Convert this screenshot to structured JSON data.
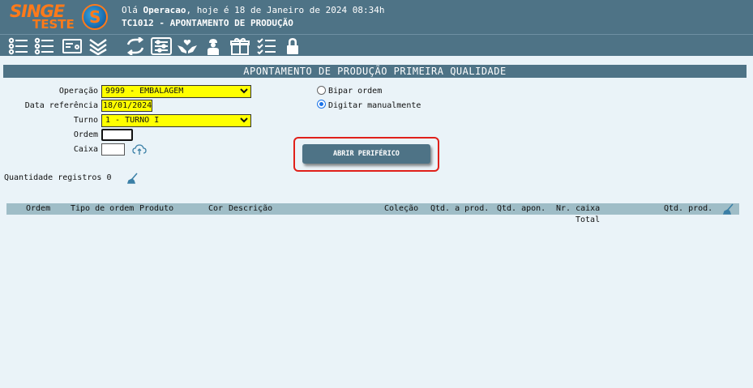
{
  "header": {
    "brand_top": "SINGE",
    "brand_bottom": "TESTE",
    "logo_letter": "S",
    "greeting_prefix": "Olá ",
    "greeting_user": "Operacao",
    "greeting_suffix": ", hoje é 18 de Janeiro de 2024 08:34h",
    "screen_title": "TC1012 - APONTAMENTO DE PRODUÇÃO"
  },
  "toolbar": {
    "icons": [
      "list-icon",
      "checklist-icon",
      "card-icon",
      "chevrons-down-icon",
      "refresh-icon",
      "sliders-icon",
      "hands-heart-icon",
      "worker-icon",
      "gift-icon",
      "tasks-icon",
      "lock-icon"
    ]
  },
  "section": {
    "title": "APONTAMENTO DE PRODUÇÃO PRIMEIRA QUALIDADE"
  },
  "form": {
    "operacao_label": "Operação",
    "operacao_value": "9999 - EMBALAGEM",
    "data_label": "Data referência",
    "data_value": "18/01/2024",
    "turno_label": "Turno",
    "turno_value": "1 - TURNO I",
    "ordem_label": "Ordem",
    "ordem_value": "",
    "caixa_label": "Caixa",
    "caixa_value": ""
  },
  "mode": {
    "option_bipar": "Bipar ordem",
    "option_digitar": "Digitar manualmente",
    "selected": "Digitar manualmente"
  },
  "actions": {
    "abrir_periferico": "ABRIR PERIFÉRICO"
  },
  "summary": {
    "label": "Quantidade registros",
    "count": "0"
  },
  "grid": {
    "columns": [
      "Ordem",
      "Tipo de ordem",
      "Produto",
      "Cor",
      "Descrição",
      "Coleção",
      "Qtd. a prod.",
      "Qtd. apon.",
      "Nr. caixa",
      "Qtd. prod."
    ],
    "total_label": "Total"
  },
  "colors": {
    "header_bg": "#4e7386",
    "brand": "#ff7a1a",
    "field_highlight": "#ffff00",
    "grid_header": "#9fbdc7",
    "callout": "#e0201a"
  }
}
